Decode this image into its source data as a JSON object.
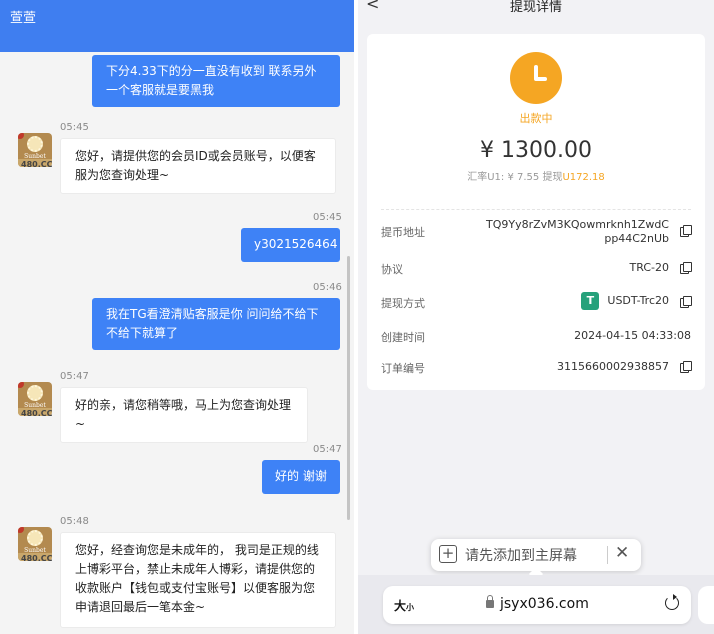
{
  "chat": {
    "header_title": "萱萱",
    "messages": [
      {
        "side": "out",
        "text": "下分4.33下的分一直没有收到 联系另外一个客服就是要黑我"
      },
      {
        "side": "in",
        "time": "05:45",
        "text": "您好，请提供您的会员ID或会员账号，以便客服为您查询处理~"
      },
      {
        "side": "out",
        "time": "05:45",
        "text": "y3021526464"
      },
      {
        "side": "out",
        "time": "05:46",
        "text": "我在TG看澄清贴客服是你 问问给不给下不给下就算了"
      },
      {
        "side": "in",
        "time": "05:47",
        "text": "好的亲，请您稍等哦，马上为您查询处理~"
      },
      {
        "side": "out",
        "time": "05:47",
        "text": "好的 谢谢"
      },
      {
        "side": "in",
        "time": "05:48",
        "text": "您好，经查询您是未成年的， 我司是正规的线上博彩平台，禁止未成年人博彩，请提供您的收款账户【钱包或支付宝账号】以便客服为您申请退回最后一笔本金~"
      }
    ],
    "avatar_brand": "Sunbet",
    "avatar_site": "480.CC"
  },
  "detail": {
    "back": "<",
    "title": "提现详情",
    "status": "出款中",
    "amount": "¥ 1300.00",
    "rate_prefix": "汇率U1: ¥ 7.55  提现",
    "rate_value": "U172.18",
    "rows": [
      {
        "label": "提币地址",
        "value_line1": "TQ9Yy8rZvM3KQowmrknh1ZwdC",
        "value_line2": "pp44C2nUb"
      },
      {
        "label": "协议",
        "value": "TRC-20"
      },
      {
        "label": "提现方式",
        "value": "USDT-Trc20",
        "icon": "tether-icon"
      },
      {
        "label": "创建时间",
        "value": "2024-04-15 04:33:08"
      },
      {
        "label": "订单编号",
        "value": "3115660002938857"
      }
    ]
  },
  "browser": {
    "popup_text": "请先添加到主屏幕",
    "aa_big": "大",
    "aa_small": "小",
    "url": "jsyx036.com"
  },
  "colors": {
    "accent_blue": "#3e82f6",
    "status_orange": "#f5a623",
    "tether_green": "#26a17b"
  }
}
